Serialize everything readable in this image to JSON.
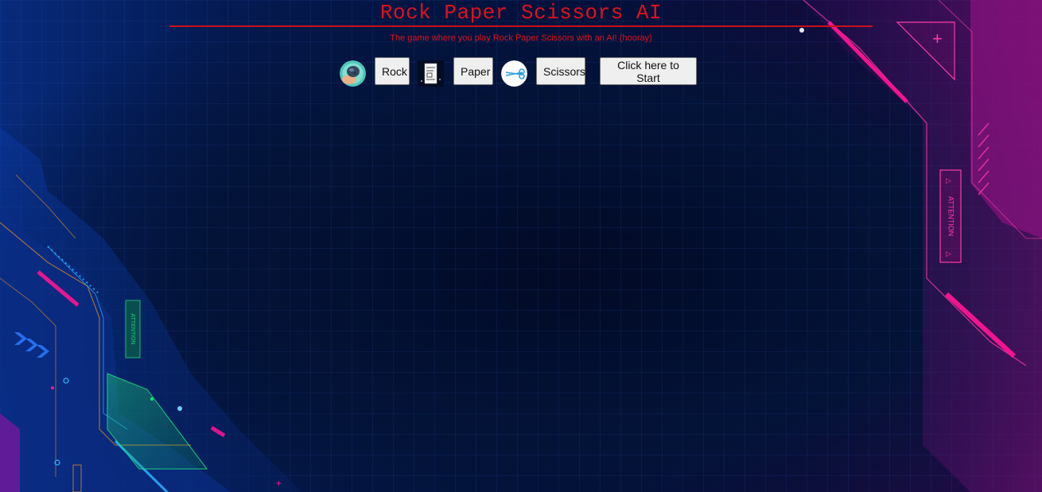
{
  "header": {
    "title": "Rock Paper Scissors AI",
    "subtitle": "The game where you play Rock Paper Scissors with an AI! (hooray)"
  },
  "controls": {
    "rock_label": "Rock",
    "paper_label": "Paper",
    "scissors_label": "Scissors",
    "start_label": "Click here to Start"
  },
  "background": {
    "left_badge_text": "ATTENTION",
    "right_badge_text": "ATTENTION"
  },
  "colors": {
    "title_red": "#e0121c",
    "neon_pink": "#ff1493",
    "neon_cyan": "#2bb6ff",
    "neon_green": "#1ee07a",
    "bg_navy": "#02103a"
  },
  "icons": {
    "rock": "rock-icon",
    "paper": "paper-icon",
    "scissors": "scissors-icon"
  }
}
